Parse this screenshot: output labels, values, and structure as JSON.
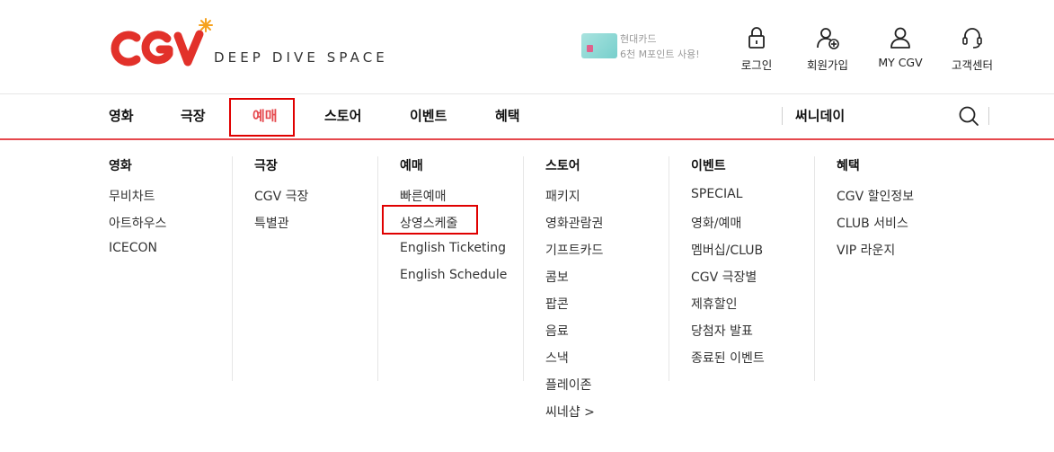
{
  "header": {
    "tagline": "DEEP DIVE SPACE",
    "promo": {
      "line1": "현대카드",
      "line2": "6천 M포인트 사용!"
    },
    "utility": [
      {
        "label": "로그인",
        "icon": "lock-icon"
      },
      {
        "label": "회원가입",
        "icon": "add-user-icon"
      },
      {
        "label": "MY CGV",
        "icon": "user-icon"
      },
      {
        "label": "고객센터",
        "icon": "headset-icon"
      }
    ],
    "brand_color": "#e5484d",
    "logo_color": "#e2312a"
  },
  "nav": {
    "items": [
      "영화",
      "극장",
      "예매",
      "스토어",
      "이벤트",
      "혜택"
    ],
    "active_index": 2,
    "search_label": "써니데이"
  },
  "menu": {
    "columns": [
      {
        "title": "영화",
        "links": [
          "무비차트",
          "아트하우스",
          "ICECON"
        ]
      },
      {
        "title": "극장",
        "links": [
          "CGV 극장",
          "특별관"
        ]
      },
      {
        "title": "예매",
        "links": [
          "빠른예매",
          "상영스케줄",
          "English Ticketing",
          "English Schedule"
        ]
      },
      {
        "title": "스토어",
        "links": [
          "패키지",
          "영화관람권",
          "기프트카드",
          "콤보",
          "팝콘",
          "음료",
          "스낵",
          "플레이존",
          "씨네샵 >"
        ]
      },
      {
        "title": "이벤트",
        "links": [
          "SPECIAL",
          "영화/예매",
          "멤버십/CLUB",
          "CGV 극장별",
          "제휴할인",
          "당첨자 발표",
          "종료된 이벤트"
        ]
      },
      {
        "title": "혜택",
        "links": [
          "CGV 할인정보",
          "CLUB 서비스",
          "VIP 라운지"
        ]
      }
    ]
  }
}
